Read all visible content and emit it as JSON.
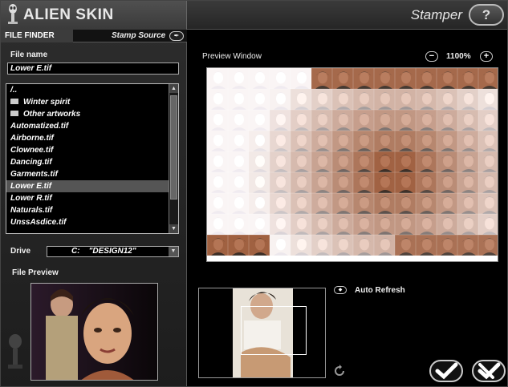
{
  "brand": "ALIEN SKIN",
  "app_title": "Stamper",
  "help_label": "?",
  "tabs": {
    "finder": "FILE FINDER",
    "source": "Stamp Source",
    "source_icon": "✒"
  },
  "file_name": {
    "label": "File name",
    "value": "Lower E.tif"
  },
  "files": [
    {
      "label": "/..",
      "type": "parent"
    },
    {
      "label": "Winter spirit",
      "type": "folder"
    },
    {
      "label": "Other artworks",
      "type": "folder"
    },
    {
      "label": "Automatized.tif",
      "type": "file"
    },
    {
      "label": "Airborne.tif",
      "type": "file"
    },
    {
      "label": "Clownee.tif",
      "type": "file"
    },
    {
      "label": "Dancing.tif",
      "type": "file"
    },
    {
      "label": "Garments.tif",
      "type": "file"
    },
    {
      "label": "Lower E.tif",
      "type": "file",
      "selected": true
    },
    {
      "label": "Lower R.tif",
      "type": "file"
    },
    {
      "label": "Naturals.tif",
      "type": "file"
    },
    {
      "label": "UnssAsdice.tif",
      "type": "file"
    }
  ],
  "drive": {
    "label": "Drive",
    "value": "C:    \"DESIGN12\""
  },
  "file_preview_label": "File Preview",
  "preview": {
    "label": "Preview Window",
    "zoom": "1100%",
    "minus": "−",
    "plus": "+"
  },
  "auto_refresh": {
    "label": "Auto Refresh",
    "dot": "◆"
  },
  "colors": {
    "accent": "#ffffff",
    "panel": "#2a2a2a",
    "bg": "#000000"
  },
  "icons": {
    "ok": "check-icon",
    "cancel": "cancel-check-icon",
    "refresh": "refresh-icon",
    "logo": "alien-logo-icon"
  }
}
